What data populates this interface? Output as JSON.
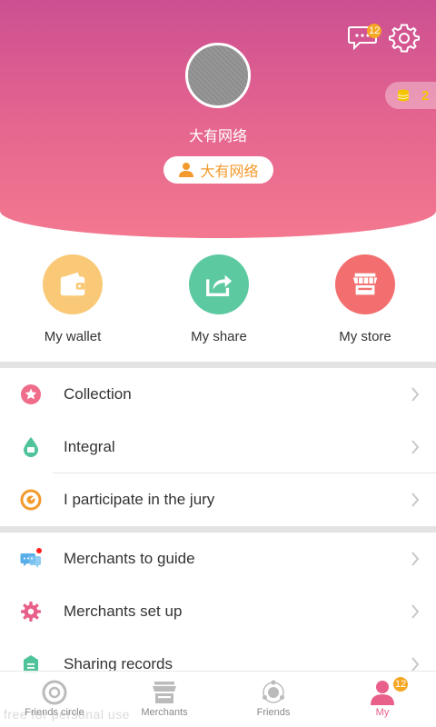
{
  "header": {
    "username": "大有网络",
    "role_label": "大有网络",
    "message_badge": "12",
    "coin_count": "2"
  },
  "quick_actions": [
    {
      "label": "My wallet",
      "icon": "wallet-icon",
      "color": "#f9c977"
    },
    {
      "label": "My share",
      "icon": "share-icon",
      "color": "#5dc9a0"
    },
    {
      "label": "My store",
      "icon": "store-icon",
      "color": "#f36f6f"
    }
  ],
  "menu": [
    {
      "label": "Collection",
      "icon": "star-icon"
    },
    {
      "label": "Integral",
      "icon": "integral-drop-icon"
    },
    {
      "label": "I participate in the jury",
      "icon": "jury-icon"
    },
    {
      "label": "Merchants to guide",
      "icon": "chat-bubbles-icon"
    },
    {
      "label": "Merchants set up",
      "icon": "gear-icon"
    },
    {
      "label": "Sharing records",
      "icon": "records-icon"
    }
  ],
  "bottom_nav": [
    {
      "label": "Friends circle",
      "icon": "friends-circle-icon"
    },
    {
      "label": "Merchants",
      "icon": "merchants-icon"
    },
    {
      "label": "Friends",
      "icon": "friends-icon"
    },
    {
      "label": "My",
      "icon": "my-person-icon",
      "badge": "12"
    }
  ],
  "watermark": "free for personal use",
  "colors": {
    "header_top": "#cc4f92",
    "header_bottom": "#f3788f",
    "accent": "#e8608a",
    "badge": "#f5a623",
    "role_text": "#f39a2c"
  }
}
